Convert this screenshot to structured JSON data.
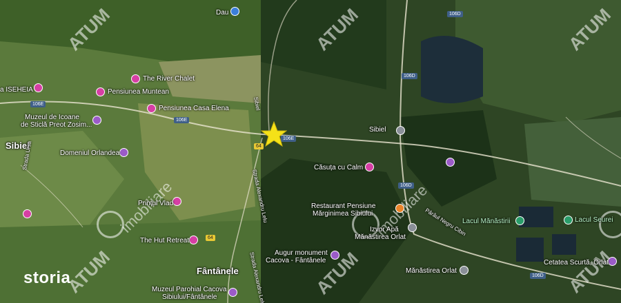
{
  "brand": "storia",
  "watermarks": [
    {
      "text": "ATUM"
    },
    {
      "text": "imobiliare"
    }
  ],
  "places": {
    "sibiel_west": "Sibiel",
    "sibiel_east": "Sibiel",
    "fantanele": "Fântânele",
    "iseheia": "a ISEHEIA",
    "dau": "Dau"
  },
  "pois": {
    "river_chalet": "The River Chalet",
    "pensiunea_muntean": "Pensiunea Muntean",
    "pensiunea_casa_elena": "Pensiunea Casa Elena",
    "muzeul_icoane_l1": "Muzeul de Icoane",
    "muzeul_icoane_l2": "de Sticlă Preot Zosim...",
    "domeniul_orlandea": "Domeniul Orlandea",
    "printul_vlad": "Prințul Vlad",
    "hut_retreat": "The Hut Retreat",
    "muzeul_parohial_l1": "Muzeul Parohial Cacova",
    "muzeul_parohial_l2": "Sibiului/Fântânele",
    "casuta_cu_calm": "Căsuța cu Calm",
    "restaurant_l1": "Restaurant Pensiune",
    "restaurant_l2": "Mărginimea Sibiului",
    "izvor_l1": "Izvor Apă",
    "izvor_l2": "Mănăstirea Orlat",
    "augur_l1": "Augur monument",
    "augur_l2": "Cacova - Fântânele",
    "manastirea_orlat": "Mănăstirea Orlat",
    "lacul_manastirii": "Lacul Mănăstirii",
    "lacul_seurei": "Lacul Seurei",
    "cetatea_l1": "Cetatea Scurtă, Orlat"
  },
  "streets": {
    "strada_ursa": "Strada Ursa",
    "strada_alexandru": "Strada Alexandru Lelu",
    "strada_alexandru_2": "Strada Alexandru Lelu",
    "paraul_negru": "Pârâul Negru Cibin",
    "sibiel_road": "Sibiel"
  },
  "road_numbers": {
    "r106e_a": "106E",
    "r106e_b": "106E",
    "r106e_c": "106E",
    "r106d_a": "106D",
    "r106d_b": "106D",
    "r106d_c": "106D",
    "r106d_d": "106D",
    "r64_a": "64",
    "r64_b": "64"
  },
  "colors": {
    "marker_star": "#f5e118",
    "poi_pink": "#d63fa4",
    "poi_purple": "#9b5bc8",
    "poi_green": "#2a9d6a"
  }
}
